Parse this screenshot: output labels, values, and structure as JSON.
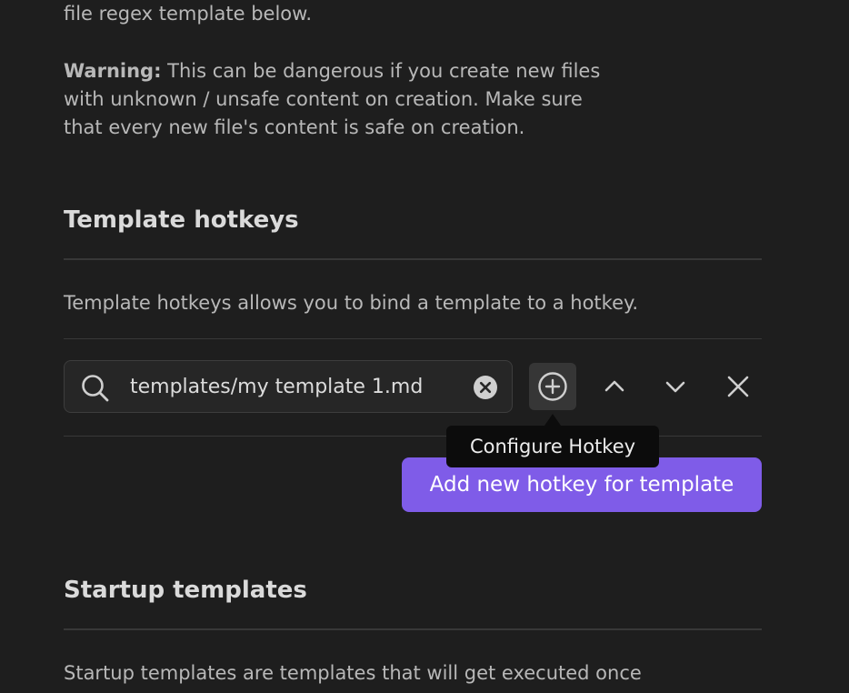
{
  "intro": {
    "partial_line": "file regex template below.",
    "warning_label": "Warning:",
    "warning_line1": " This can be dangerous if you create new files",
    "warning_line2": "with unknown / unsafe content on creation. Make sure",
    "warning_line3": "that every new file's content is safe on creation."
  },
  "template_hotkeys": {
    "title": "Template hotkeys",
    "description": "Template hotkeys allows you to bind a template to a hotkey.",
    "search": {
      "value": "templates/my template 1.md",
      "placeholder": ""
    },
    "tooltip": "Configure Hotkey",
    "add_button_label": "Add new hotkey for template"
  },
  "startup_templates": {
    "title": "Startup templates",
    "description": "Startup templates are templates that will get executed once"
  },
  "icons": {
    "search": "search-icon",
    "clear": "clear-circle-icon",
    "hotkey": "plus-circle-icon",
    "move_up": "chevron-up-icon",
    "move_down": "chevron-down-icon",
    "delete": "close-icon"
  },
  "colors": {
    "background": "#1e1e1e",
    "accent": "#7f5ce8",
    "text": "#b8b8b8",
    "heading": "#dadada"
  }
}
